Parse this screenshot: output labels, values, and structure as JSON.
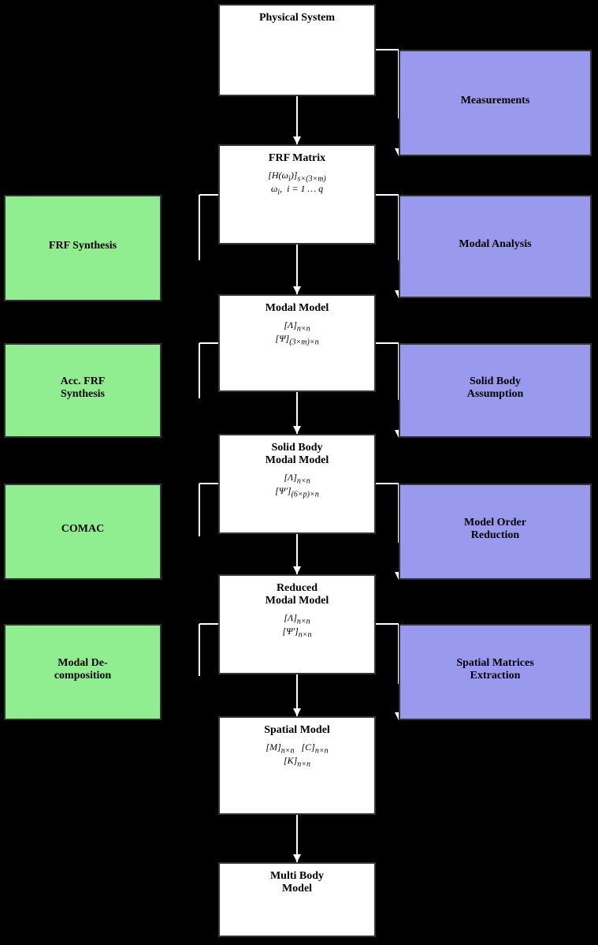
{
  "boxes": {
    "physical_system": {
      "title": "Physical System",
      "formulas": []
    },
    "frf_matrix": {
      "title": "FRF Matrix",
      "formulas": [
        "[H(ωᵢ)]ₛ×(3×m)",
        "ωᵢ,  i = 1 … q"
      ]
    },
    "modal_model": {
      "title": "Modal Model",
      "formulas": [
        "[Λ]ₙₓₙ",
        "[Ψ](3×m)×n"
      ]
    },
    "solid_body_modal_model": {
      "title": "Solid Body Modal Model",
      "formulas": [
        "[Λ]ₙₓₙ",
        "[Ψ'](6×p)×n"
      ]
    },
    "reduced_modal_model": {
      "title": "Reduced Modal Model",
      "formulas": [
        "[Λ]ₙₓₙ",
        "[Ψ']ₙₓₙ"
      ]
    },
    "spatial_model": {
      "title": "Spatial Model",
      "formulas": [
        "[M]ₙₓₙ   [C]ₙₓₙ",
        "[K]ₙₓₙ"
      ]
    },
    "multi_body_model": {
      "title": "Multi Body Model",
      "formulas": []
    },
    "measurements": {
      "title": "Measurements"
    },
    "modal_analysis": {
      "title": "Modal Analysis"
    },
    "solid_body_assumption": {
      "title": "Solid Body Assumption"
    },
    "model_order_reduction": {
      "title": "Model Order Reduction"
    },
    "spatial_matrices_extraction": {
      "title": "Spatial Matrices Extraction"
    },
    "frf_synthesis": {
      "title": "FRF Synthesis"
    },
    "acc_frf_synthesis": {
      "title": "Acc. FRF Synthesis"
    },
    "comac": {
      "title": "COMAC"
    },
    "modal_decomposition": {
      "title": "Modal Decomposition"
    }
  }
}
